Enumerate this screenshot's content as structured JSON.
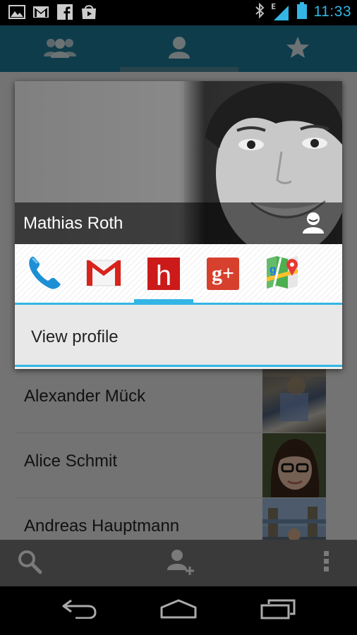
{
  "status_bar": {
    "time": "11:33",
    "network_type": "E",
    "left_icons": [
      "gallery-icon",
      "gmail-icon",
      "facebook-icon",
      "play-store-icon"
    ],
    "right_icons": [
      "bluetooth-icon",
      "signal-icon",
      "battery-icon"
    ]
  },
  "tabs": [
    {
      "name": "groups",
      "icon": "groups-icon"
    },
    {
      "name": "all-contacts",
      "icon": "person-icon",
      "selected": true
    },
    {
      "name": "favorites",
      "icon": "star-icon"
    }
  ],
  "quick_contact": {
    "name": "Mathias Roth",
    "actions": [
      {
        "name": "call",
        "icon": "phone-icon"
      },
      {
        "name": "gmail",
        "icon": "gmail-icon"
      },
      {
        "name": "hangouts-h",
        "icon": "h-app-icon",
        "selected": true
      },
      {
        "name": "google-plus",
        "icon": "google-plus-icon",
        "label": "g+"
      },
      {
        "name": "maps",
        "icon": "maps-icon"
      }
    ],
    "view_profile_label": "View profile",
    "h_letter": "h",
    "gplus_label": "g+"
  },
  "contacts": [
    {
      "name": "Alexander Mück"
    },
    {
      "name": "Alice Schmit"
    },
    {
      "name": "Andreas Hauptmann"
    }
  ],
  "bottom_bar": {
    "icons": [
      "search-icon",
      "add-contact-icon",
      "overflow-menu-icon"
    ]
  },
  "nav_bar": {
    "icons": [
      "back-icon",
      "home-icon",
      "recents-icon"
    ]
  },
  "colors": {
    "accent": "#33b5e5",
    "action_bar": "#1f7895",
    "h_app_red": "#cc1a1a",
    "gplus_red": "#d6402d"
  }
}
